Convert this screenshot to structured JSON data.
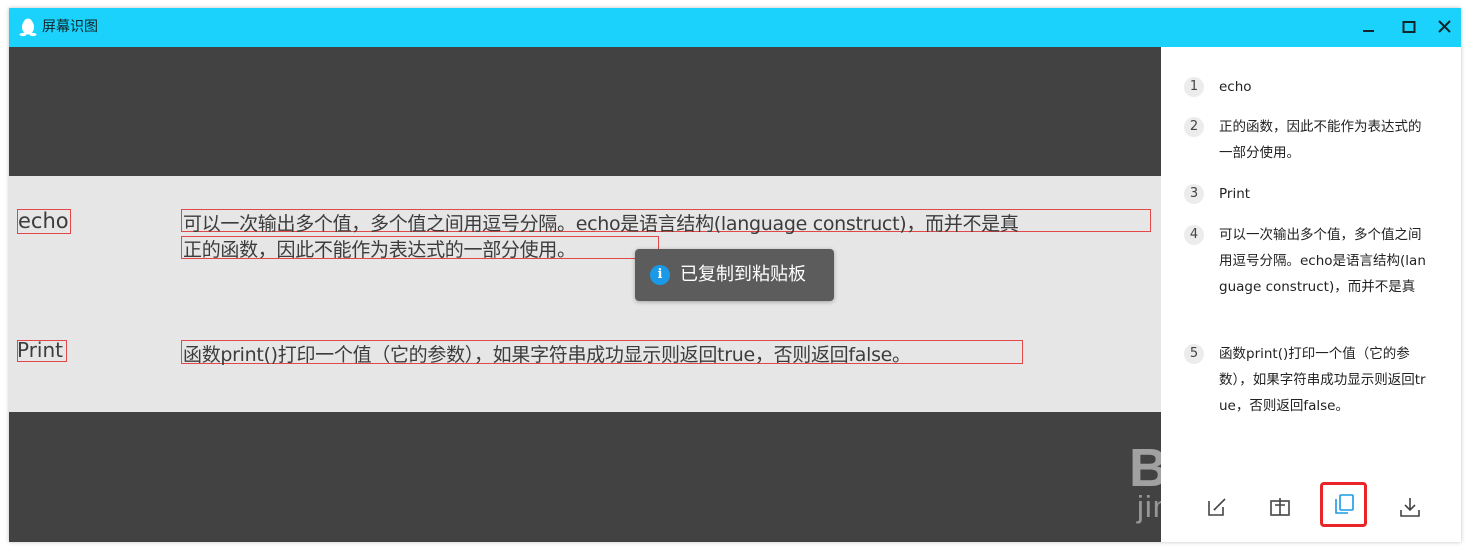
{
  "window": {
    "title": "屏幕识图",
    "accent_color": "#1ad2fb"
  },
  "preview": {
    "lines": [
      {
        "label": "echo",
        "text_line1": "可以一次输出多个值，多个值之间用逗号分隔。echo是语言结构(language construct)，而并不是真",
        "text_line2": "正的函数，因此不能作为表达式的一部分使用。"
      },
      {
        "label": "Print",
        "text_line1": "函数print()打印一个值（它的参数），如果字符串成功显示则返回true，否则返回false。"
      }
    ]
  },
  "toast": {
    "icon": "info-icon",
    "message": "已复制到粘贴板"
  },
  "results": [
    {
      "num": "1",
      "text": "echo"
    },
    {
      "num": "2",
      "text": "正的函数，因此不能作为表达式的一部分使用。"
    },
    {
      "num": "3",
      "text": "Print"
    },
    {
      "num": "4",
      "text": "可以一次输出多个值，多个值之间用逗号分隔。echo是语言结构(language construct)，而并不是真"
    },
    {
      "num": "5",
      "text": "函数print()打印一个值（它的参数），如果字符串成功显示则返回true，否则返回false。"
    }
  ],
  "toolbar": {
    "icons": [
      "edit-icon",
      "translate-icon",
      "copy-icon",
      "download-icon"
    ],
    "highlight_color": "#e8262a"
  },
  "watermark": {
    "brand": "Bai du 经验",
    "url": "jingyan.baidu.com"
  }
}
